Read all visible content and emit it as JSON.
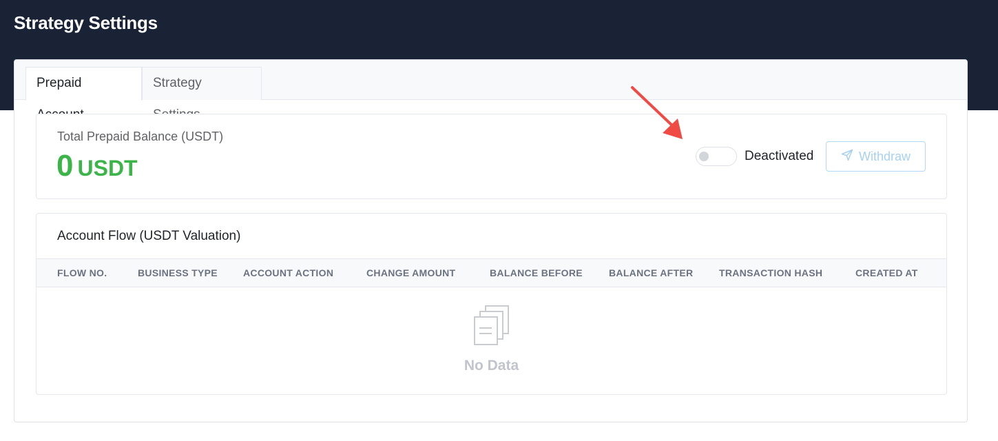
{
  "header": {
    "title": "Strategy Settings"
  },
  "tabs": [
    {
      "label": "Prepaid Account",
      "active": true
    },
    {
      "label": "Strategy Settings",
      "active": false
    }
  ],
  "balance": {
    "label": "Total Prepaid Balance (USDT)",
    "value": "0",
    "unit": "USDT",
    "color": "#3bb54a"
  },
  "toggle": {
    "label": "Deactivated",
    "state": "off"
  },
  "withdraw": {
    "label": "Withdraw",
    "icon": "send-icon",
    "disabled": true
  },
  "account_flow": {
    "title": "Account Flow (USDT Valuation)",
    "columns": [
      "FLOW NO.",
      "BUSINESS TYPE",
      "ACCOUNT ACTION",
      "CHANGE AMOUNT",
      "BALANCE BEFORE",
      "BALANCE AFTER",
      "TRANSACTION HASH",
      "CREATED AT"
    ],
    "rows": [],
    "empty_text": "No Data",
    "empty_icon": "documents-icon"
  },
  "annotation": {
    "icon": "red-arrow-icon",
    "color": "#f04a45"
  }
}
